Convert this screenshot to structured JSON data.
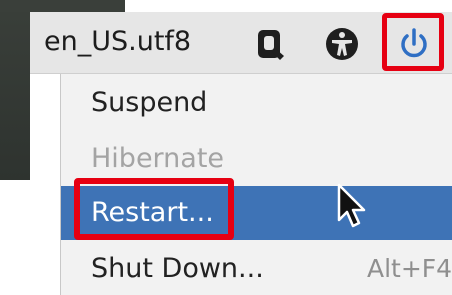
{
  "topbar": {
    "locale": "en_US.utf8",
    "icons": [
      "keyboard-layout-icon",
      "accessibility-icon",
      "power-icon"
    ]
  },
  "power_menu": {
    "items": [
      {
        "label": "Suspend",
        "state": "enabled"
      },
      {
        "label": "Hibernate",
        "state": "disabled"
      },
      {
        "label": "Restart...",
        "state": "selected"
      },
      {
        "label": "Shut Down...",
        "state": "enabled",
        "shortcut": "Alt+F4"
      }
    ]
  },
  "colors": {
    "selection": "#3e73b6",
    "highlight_box": "#e60012",
    "power_icon": "#2f6fc4",
    "panel_bg": "#e6e6e6",
    "menu_bg": "#f2f2f2"
  }
}
